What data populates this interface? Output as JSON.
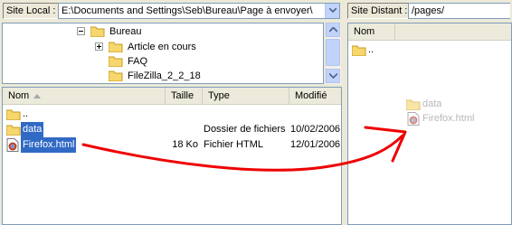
{
  "local": {
    "site_label": "Site Local :",
    "path": "E:\\Documents and Settings\\Seb\\Bureau\\Page à envoyer\\",
    "tree": [
      {
        "label": "Bureau",
        "expander": "minus"
      },
      {
        "label": "Article en cours",
        "expander": "plus"
      },
      {
        "label": "FAQ",
        "expander": ""
      },
      {
        "label": "FileZilla_2_2_18",
        "expander": ""
      }
    ],
    "columns": {
      "name": "Nom",
      "size": "Taille",
      "type": "Type",
      "modified": "Modifié"
    },
    "files": [
      {
        "name": "..",
        "size": "",
        "type": "",
        "modified": "",
        "icon": "folder-icon",
        "selected": false
      },
      {
        "name": "data",
        "size": "",
        "type": "Dossier de fichiers",
        "modified": "10/02/2006",
        "icon": "folder-icon",
        "selected": true
      },
      {
        "name": "Firefox.html",
        "size": "18 Ko",
        "type": "Fichier HTML",
        "modified": "12/01/2006",
        "icon": "html-file-icon",
        "selected": true
      }
    ]
  },
  "remote": {
    "site_label": "Site Distant :",
    "path": "/pages/",
    "columns": {
      "name": "Nom"
    },
    "files": [
      {
        "name": "..",
        "icon": "folder-icon"
      }
    ],
    "dragged": [
      {
        "name": "data",
        "icon": "folder-icon"
      },
      {
        "name": "Firefox.html",
        "icon": "html-file-icon"
      }
    ]
  },
  "colors": {
    "selection": "#316ac5",
    "drag_arrow": "#ff0000",
    "folder": "#f5d76e"
  }
}
